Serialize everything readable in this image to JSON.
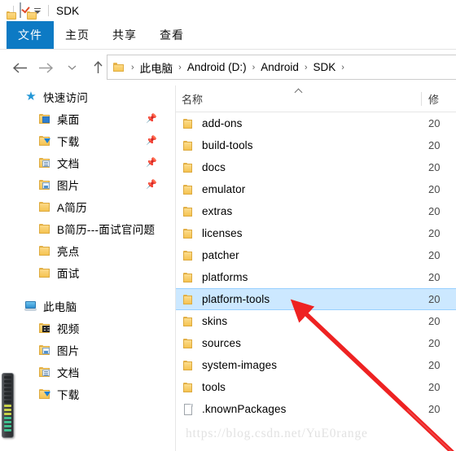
{
  "window": {
    "title": "SDK",
    "quick_access_toolbar": [
      {
        "icon": "folder-icon",
        "name": "folder-icon"
      },
      {
        "icon": "properties-icon",
        "name": "properties-icon"
      },
      {
        "icon": "folder-icon",
        "name": "new-folder-icon"
      },
      {
        "icon": "chevron-down-icon",
        "name": "customize-qat-icon"
      }
    ]
  },
  "ribbon": {
    "tabs": [
      {
        "label": "文件",
        "active": true
      },
      {
        "label": "主页",
        "active": false
      },
      {
        "label": "共享",
        "active": false
      },
      {
        "label": "查看",
        "active": false
      }
    ],
    "accent_color": "#0d7ac4"
  },
  "address_bar": {
    "back_icon": "back-arrow-icon",
    "forward_icon": "forward-arrow-icon",
    "recent_icon": "chevron-down-icon",
    "up_icon": "up-arrow-icon",
    "breadcrumb": [
      "此电脑",
      "Android (D:)",
      "Android",
      "SDK"
    ],
    "separator": "›"
  },
  "nav_pane": {
    "sections": [
      {
        "title": "快速访问",
        "icon": "star-icon",
        "items": [
          {
            "label": "桌面",
            "icon": "desktop-folder-icon",
            "pinned": true
          },
          {
            "label": "下载",
            "icon": "downloads-folder-icon",
            "pinned": true
          },
          {
            "label": "文档",
            "icon": "documents-folder-icon",
            "pinned": true
          },
          {
            "label": "图片",
            "icon": "pictures-folder-icon",
            "pinned": true
          },
          {
            "label": "A简历",
            "icon": "folder-icon",
            "pinned": false
          },
          {
            "label": "B简历---面试官问题",
            "icon": "folder-icon",
            "pinned": false
          },
          {
            "label": "亮点",
            "icon": "folder-icon",
            "pinned": false
          },
          {
            "label": "面试",
            "icon": "folder-icon",
            "pinned": false
          }
        ]
      },
      {
        "title": "此电脑",
        "icon": "this-pc-icon",
        "items": [
          {
            "label": "视频",
            "icon": "videos-folder-icon",
            "pinned": false
          },
          {
            "label": "图片",
            "icon": "pictures-folder-icon",
            "pinned": false
          },
          {
            "label": "文档",
            "icon": "documents-folder-icon",
            "pinned": false
          },
          {
            "label": "下载",
            "icon": "downloads-folder-icon",
            "pinned": false
          }
        ]
      }
    ]
  },
  "file_list": {
    "columns": [
      {
        "label": "名称",
        "sorted": "asc"
      },
      {
        "label": "修"
      }
    ],
    "rows": [
      {
        "name": "add-ons",
        "icon": "folder-icon",
        "date": "20",
        "selected": false
      },
      {
        "name": "build-tools",
        "icon": "folder-icon",
        "date": "20",
        "selected": false
      },
      {
        "name": "docs",
        "icon": "folder-icon",
        "date": "20",
        "selected": false
      },
      {
        "name": "emulator",
        "icon": "folder-icon",
        "date": "20",
        "selected": false
      },
      {
        "name": "extras",
        "icon": "folder-icon",
        "date": "20",
        "selected": false
      },
      {
        "name": "licenses",
        "icon": "folder-icon",
        "date": "20",
        "selected": false
      },
      {
        "name": "patcher",
        "icon": "folder-icon",
        "date": "20",
        "selected": false
      },
      {
        "name": "platforms",
        "icon": "folder-icon",
        "date": "20",
        "selected": false
      },
      {
        "name": "platform-tools",
        "icon": "folder-icon",
        "date": "20",
        "selected": true
      },
      {
        "name": "skins",
        "icon": "folder-icon",
        "date": "20",
        "selected": false
      },
      {
        "name": "sources",
        "icon": "folder-icon",
        "date": "20",
        "selected": false
      },
      {
        "name": "system-images",
        "icon": "folder-icon",
        "date": "20",
        "selected": false
      },
      {
        "name": "tools",
        "icon": "folder-icon",
        "date": "20",
        "selected": false
      },
      {
        "name": ".knownPackages",
        "icon": "file-icon",
        "date": "20",
        "selected": false
      }
    ],
    "selection_color": "#cce8ff"
  },
  "annotation": {
    "arrow_color": "#ee2222",
    "points_to": "platform-tools"
  },
  "watermark": {
    "text": "https://blog.csdn.net/YuE0range"
  }
}
